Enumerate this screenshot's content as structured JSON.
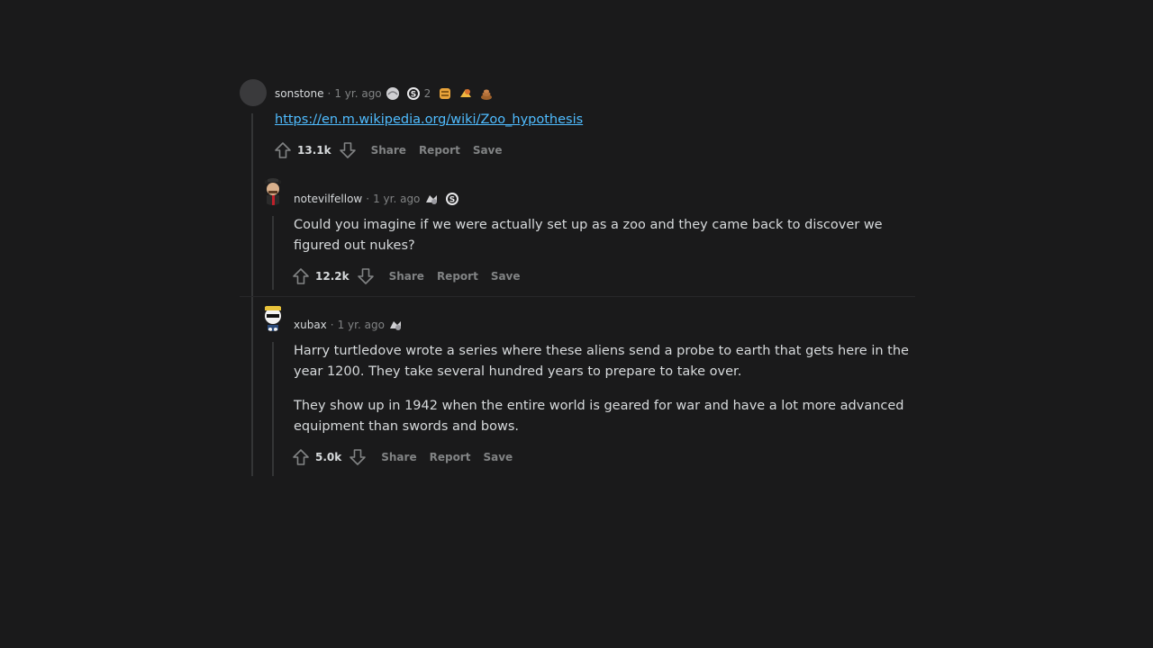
{
  "comments": [
    {
      "username": "sonstone",
      "time": "1 yr. ago",
      "award_count": "2",
      "link": "https://en.m.wikipedia.org/wiki/Zoo_hypothesis",
      "score": "13.1k",
      "actions": {
        "share": "Share",
        "report": "Report",
        "save": "Save"
      }
    },
    {
      "username": "notevilfellow",
      "time": "1 yr. ago",
      "body": [
        "Could you imagine if we were actually set up as a zoo and they came back to discover we figured out nukes?"
      ],
      "score": "12.2k",
      "actions": {
        "share": "Share",
        "report": "Report",
        "save": "Save"
      }
    },
    {
      "username": "xubax",
      "time": "1 yr. ago",
      "body": [
        "Harry turtledove wrote a series where these aliens send a probe to earth that gets here in the year 1200. They take several hundred years to prepare to take over.",
        "They show up in 1942 when the entire world is geared for war and have a lot more advanced equipment than swords and bows."
      ],
      "score": "5.0k",
      "actions": {
        "share": "Share",
        "report": "Report",
        "save": "Save"
      }
    }
  ],
  "icons": {
    "upvote": "arrow-up-icon",
    "downvote": "arrow-down-icon"
  },
  "colors": {
    "background": "#1a1a1b",
    "link": "#4fbcff",
    "meta": "#818384",
    "text": "#d7dadc"
  }
}
